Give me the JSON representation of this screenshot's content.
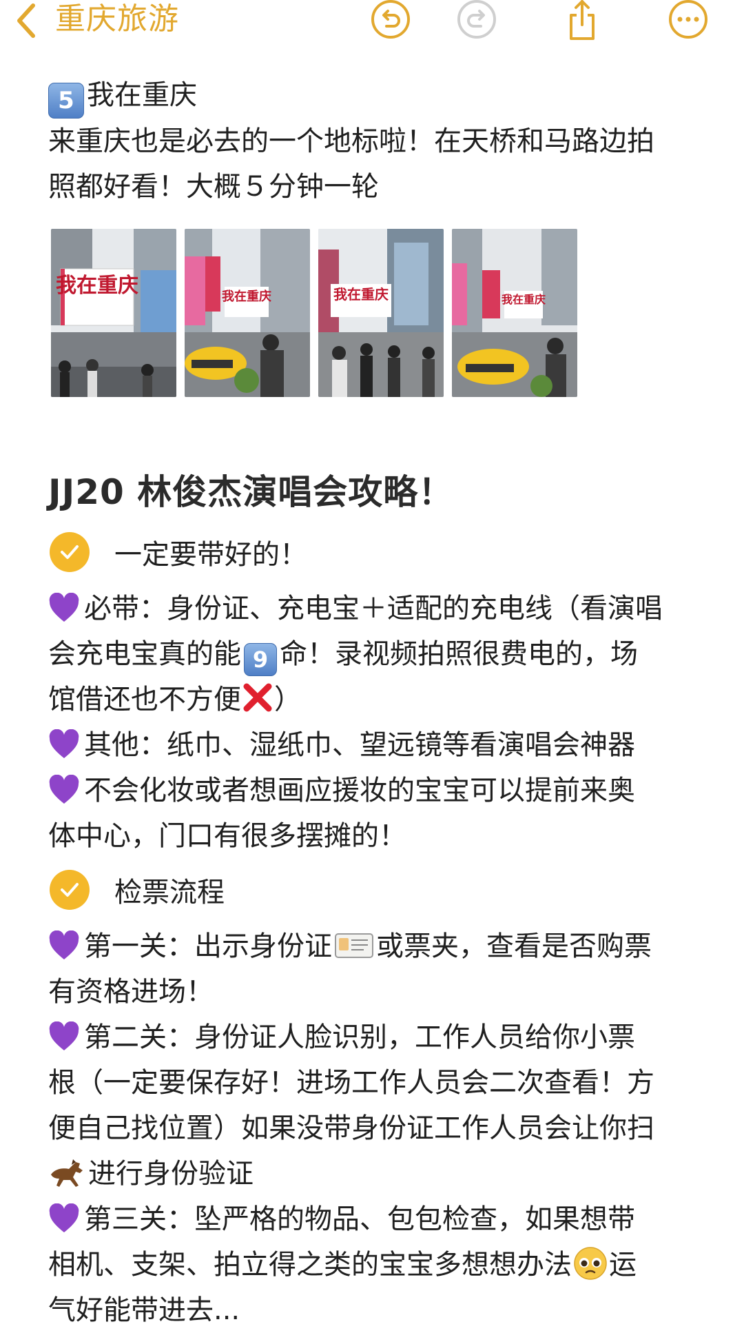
{
  "nav": {
    "back_icon": "chevron-left-icon",
    "title": "重庆旅游",
    "undo_icon": "undo-icon",
    "redo_icon": "redo-icon",
    "share_icon": "share-icon",
    "more_icon": "more-icon",
    "accent_color": "#e2a82f"
  },
  "section5": {
    "number": "5",
    "title": "我在重庆",
    "line1": "来重庆也是必去的一个地标啦！在天桥和马路边拍",
    "line2": "照都好看！大概５分钟一轮",
    "photos": [
      {
        "sign": "我在重庆"
      },
      {
        "sign": "我在重庆"
      },
      {
        "sign": "我在重庆"
      },
      {
        "sign": "我在重庆"
      }
    ]
  },
  "guide": {
    "heading": "JJ20 林俊杰演唱会攻略！",
    "check1_label": "一定要带好的！",
    "b1_line1": "必带：身份证、充电宝＋适配的充电线（看演唱",
    "b1_line2a": "会充电宝真的能",
    "b1_number": "9",
    "b1_line2b": "命！录视频拍照很费电的，场",
    "b1_line3": "馆借还也不方便",
    "b1_line3_end": "）",
    "b2": "其他：纸巾、湿纸巾、望远镜等看演唱会神器",
    "b3_line1": "不会化妆或者想画应援妆的宝宝可以提前来奥",
    "b3_line2": "体中心，门口有很多摆摊的！",
    "check2_label": "检票流程",
    "s1_line1a": "第一关：出示身份证",
    "s1_line1b": "或票夹，查看是否购票",
    "s1_line2": "有资格进场！",
    "s2_line1": "第二关：身份证人脸识别，工作人员给你小票",
    "s2_line2": "根（一定要保存好！进场工作人员会二次查看！方",
    "s2_line3": "便自己找位置）如果没带身份证工作人员会让你扫",
    "s2_line4": "进行身份验证",
    "s3_line1": "第三关：坠严格的物品、包包检查，如果想带",
    "s3_line2a": "相机、支架、拍立得之类的宝宝多想想办法",
    "s3_line2b": "运",
    "s3_line3": "气好能带进去..."
  }
}
